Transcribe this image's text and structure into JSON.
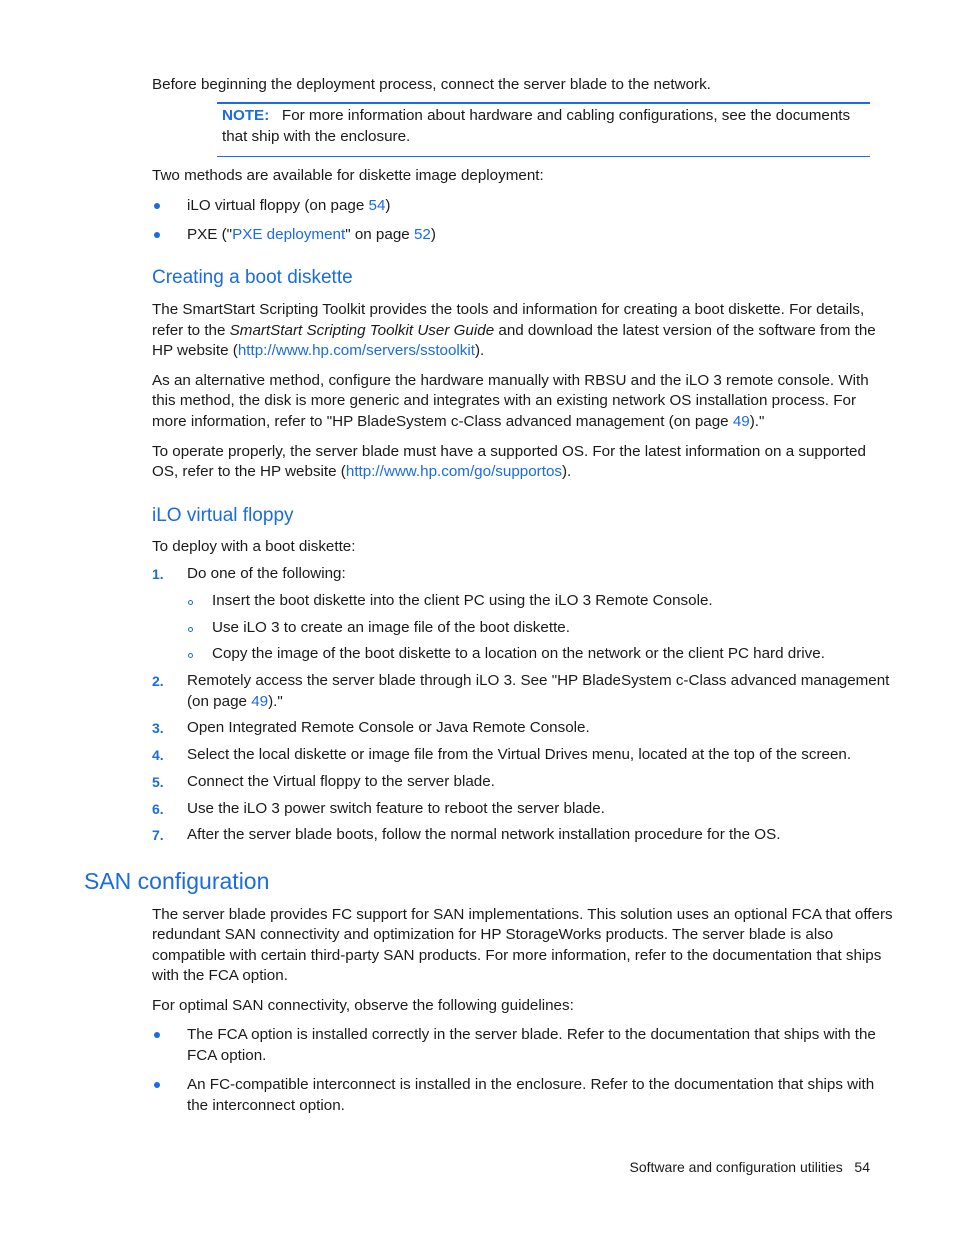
{
  "intro": "Before beginning the deployment process, connect the server blade to the network.",
  "note": {
    "label": "NOTE:",
    "line1": "For more information about hardware and cabling configurations, see the documents",
    "line2": "that ship with the enclosure."
  },
  "methods_intro": "Two methods are available for diskette image deployment:",
  "methods": [
    {
      "pre": "iLO virtual floppy (on page ",
      "link": "54",
      "post": ")"
    },
    {
      "pre": "PXE (\"",
      "link": "PXE deployment",
      "mid": "\" on page ",
      "link2": "52",
      "post": ")"
    }
  ],
  "section_boot": {
    "heading": "Creating a boot diskette",
    "p1": {
      "l1": "The SmartStart Scripting Toolkit provides the tools and information for creating a boot diskette. For details,",
      "l2_pre": "refer to the ",
      "l2_italic": "SmartStart Scripting Toolkit User Guide",
      "l2_post": " and download the latest version of the software from the",
      "l3_pre": "HP website (",
      "l3_link": "http://www.hp.com/servers/sstoolkit",
      "l3_post": ")."
    },
    "p2": {
      "l1": "As an alternative method, configure the hardware manually with RBSU and the iLO 3 remote console. With",
      "l2": "this method, the disk is more generic and integrates with an existing network OS installation process. For",
      "l3_pre": "more information, refer to \"HP BladeSystem c-Class advanced management (on page ",
      "l3_link": "49",
      "l3_post": ").\""
    },
    "p3": {
      "l1": "To operate properly, the server blade must have a supported OS. For the latest information on a supported",
      "l2_pre": "OS, refer to the HP website (",
      "l2_link": "http://www.hp.com/go/supportos",
      "l2_post": ")."
    }
  },
  "section_ilo": {
    "heading": "iLO virtual floppy",
    "intro": "To deploy with a boot diskette:",
    "steps": [
      {
        "num": "1.",
        "text": "Do one of the following:"
      },
      {
        "num": "2.",
        "text": "Remotely access the server blade through iLO 3. See \"HP BladeSystem c-Class advanced management",
        "text2_pre": "(on page ",
        "text2_link": "49",
        "text2_post": ").\""
      },
      {
        "num": "3.",
        "text": "Open Integrated Remote Console or Java Remote Console."
      },
      {
        "num": "4.",
        "text": "Select the local diskette or image file from the Virtual Drives menu, located at the top of the screen."
      },
      {
        "num": "5.",
        "text": "Connect the Virtual floppy to the server blade."
      },
      {
        "num": "6.",
        "text": "Use the iLO 3 power switch feature to reboot the server blade."
      },
      {
        "num": "7.",
        "text": "After the server blade boots, follow the normal network installation procedure for the OS."
      }
    ],
    "substeps": [
      "Insert the boot diskette into the client PC using the iLO 3 Remote Console.",
      "Use iLO 3 to create an image file of the boot diskette.",
      "Copy the image of the boot diskette to a location on the network or the client PC hard drive."
    ]
  },
  "section_san": {
    "heading": "SAN configuration",
    "p1": [
      "The server blade provides FC support for SAN implementations. This solution uses an optional FCA that offers",
      "redundant SAN connectivity and optimization for HP StorageWorks products. The server blade is also",
      "compatible with certain third-party SAN products. For more information, refer to the documentation that ships",
      "with the FCA option."
    ],
    "p2": "For optimal SAN connectivity, observe the following guidelines:",
    "guidelines": [
      {
        "l1": "The FCA option is installed correctly in the server blade. Refer to the documentation that ships with the",
        "l2": "FCA option."
      },
      {
        "l1": "An FC-compatible interconnect is installed in the enclosure. Refer to the documentation that ships with",
        "l2": "the interconnect option."
      }
    ]
  },
  "footer": {
    "section": "Software and configuration utilities",
    "page": "54"
  }
}
